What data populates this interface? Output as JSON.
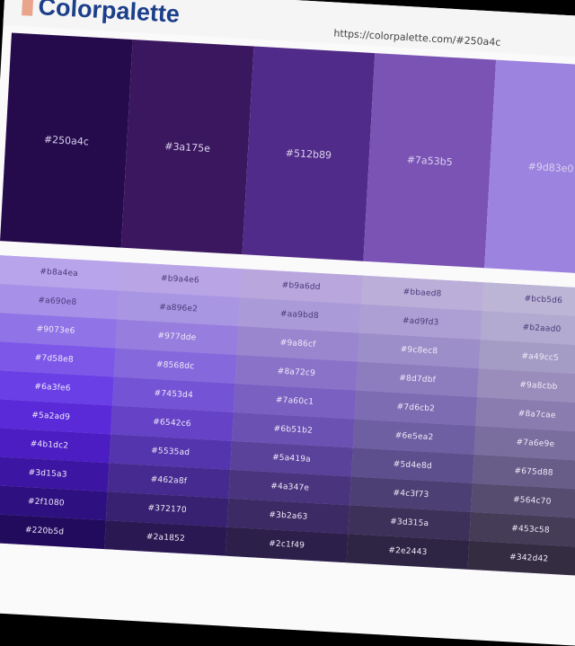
{
  "header": {
    "logo_text": "Colorpalette",
    "url": "https://colorpalette.com/#250a4c"
  },
  "main_swatches": [
    {
      "hex": "#250a4c",
      "label": "#250a4c"
    },
    {
      "hex": "#3a175e",
      "label": "#3a175e"
    },
    {
      "hex": "#512b89",
      "label": "#512b89"
    },
    {
      "hex": "#7a53b5",
      "label": "#7a53b5"
    },
    {
      "hex": "#9d83e0",
      "label": "#9d83e0"
    }
  ],
  "shade_rows": [
    [
      "#b8a4ea",
      "#b9a4e6",
      "#b9a6dd",
      "#bbaed8",
      "#bcb5d6"
    ],
    [
      "#a690e8",
      "#a896e2",
      "#aa9bd8",
      "#ad9fd3",
      "#b2aad0"
    ],
    [
      "#9073e6",
      "#977dde",
      "#9a86cf",
      "#9c8ec8",
      "#a49cc5"
    ],
    [
      "#7d58e8",
      "#8568dc",
      "#8a72c9",
      "#8d7dbf",
      "#9a8cbb"
    ],
    [
      "#6a3fe6",
      "#7453d4",
      "#7a60c1",
      "#7d6cb2",
      "#8a7cae"
    ],
    [
      "#5a2ad9",
      "#6542c6",
      "#6b51b2",
      "#6e5ea2",
      "#7a6e9e"
    ],
    [
      "#4b1dc2",
      "#5535ad",
      "#5a419a",
      "#5d4e8d",
      "#675d88"
    ],
    [
      "#3d15a3",
      "#462a8f",
      "#4a347e",
      "#4c3f73",
      "#564c70"
    ],
    [
      "#2f1080",
      "#372170",
      "#3b2a63",
      "#3d315a",
      "#453c58"
    ],
    [
      "#220b5d",
      "#2a1852",
      "#2c1f49",
      "#2e2443",
      "#342d42"
    ]
  ]
}
